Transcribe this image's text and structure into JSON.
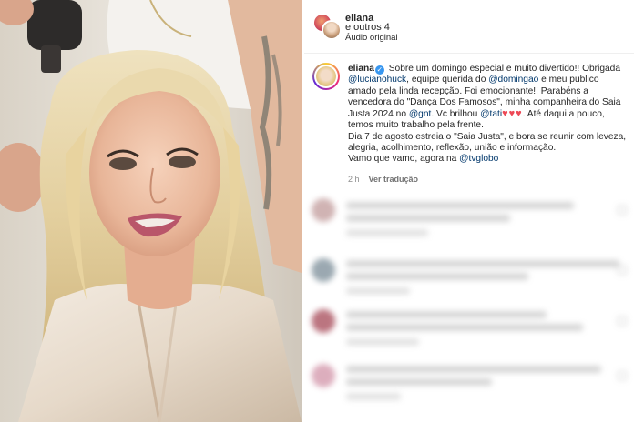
{
  "header": {
    "username": "eliana",
    "collab_text": "e outros 4",
    "audio_label": "Áudio original"
  },
  "post": {
    "username": "eliana",
    "caption": {
      "p1": "Sobre um domingo especial e muito divertido!! Obrigada ",
      "m1": "@lucianohuck",
      "p2": ", equipe querida do ",
      "m2": "@domingao",
      "p3": " e meu publico amado pela linda recepção. Foi emocionante!! Parabéns a vencedora do \"Dança Dos Famosos\", minha companheira do Saia Justa 2024 no ",
      "m3": "@gnt",
      "p4": ". Vc brilhou ",
      "m4": "@tati",
      "hearts": "♥♥♥",
      "p5": ". Até daqui a pouco, temos muito trabalho pela frente.",
      "p6": "Dia 7 de agosto estreia o \"Saia Justa\", e bora se reunir com leveza, alegria, acolhimento, reflexão, união e informação.",
      "p7": "Vamo que vamo, agora na ",
      "m5": "@tvglobo"
    },
    "time": "2 h",
    "translate_label": "Ver tradução"
  },
  "icons": {
    "verified": "verified-badge-icon",
    "like": "heart-outline-icon"
  },
  "colors": {
    "mention": "#00376b",
    "verified": "#3897f0",
    "heart": "#ed4956",
    "meta": "#8e8e8e"
  }
}
